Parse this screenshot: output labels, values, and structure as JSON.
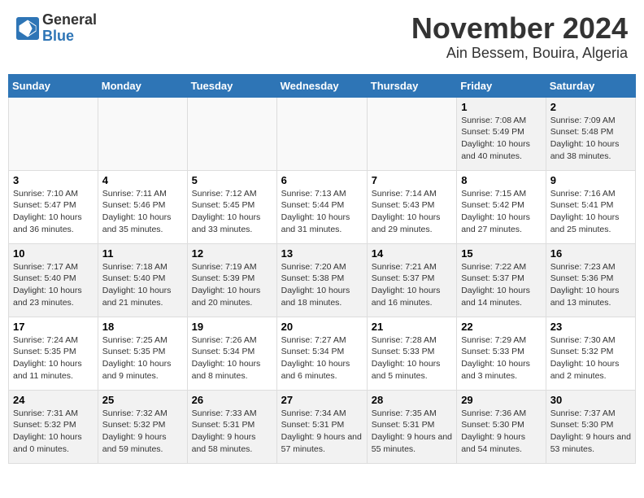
{
  "header": {
    "logo_general": "General",
    "logo_blue": "Blue",
    "month": "November 2024",
    "location": "Ain Bessem, Bouira, Algeria"
  },
  "days_of_week": [
    "Sunday",
    "Monday",
    "Tuesday",
    "Wednesday",
    "Thursday",
    "Friday",
    "Saturday"
  ],
  "weeks": [
    [
      {
        "day": "",
        "info": ""
      },
      {
        "day": "",
        "info": ""
      },
      {
        "day": "",
        "info": ""
      },
      {
        "day": "",
        "info": ""
      },
      {
        "day": "",
        "info": ""
      },
      {
        "day": "1",
        "info": "Sunrise: 7:08 AM\nSunset: 5:49 PM\nDaylight: 10 hours and 40 minutes."
      },
      {
        "day": "2",
        "info": "Sunrise: 7:09 AM\nSunset: 5:48 PM\nDaylight: 10 hours and 38 minutes."
      }
    ],
    [
      {
        "day": "3",
        "info": "Sunrise: 7:10 AM\nSunset: 5:47 PM\nDaylight: 10 hours and 36 minutes."
      },
      {
        "day": "4",
        "info": "Sunrise: 7:11 AM\nSunset: 5:46 PM\nDaylight: 10 hours and 35 minutes."
      },
      {
        "day": "5",
        "info": "Sunrise: 7:12 AM\nSunset: 5:45 PM\nDaylight: 10 hours and 33 minutes."
      },
      {
        "day": "6",
        "info": "Sunrise: 7:13 AM\nSunset: 5:44 PM\nDaylight: 10 hours and 31 minutes."
      },
      {
        "day": "7",
        "info": "Sunrise: 7:14 AM\nSunset: 5:43 PM\nDaylight: 10 hours and 29 minutes."
      },
      {
        "day": "8",
        "info": "Sunrise: 7:15 AM\nSunset: 5:42 PM\nDaylight: 10 hours and 27 minutes."
      },
      {
        "day": "9",
        "info": "Sunrise: 7:16 AM\nSunset: 5:41 PM\nDaylight: 10 hours and 25 minutes."
      }
    ],
    [
      {
        "day": "10",
        "info": "Sunrise: 7:17 AM\nSunset: 5:40 PM\nDaylight: 10 hours and 23 minutes."
      },
      {
        "day": "11",
        "info": "Sunrise: 7:18 AM\nSunset: 5:40 PM\nDaylight: 10 hours and 21 minutes."
      },
      {
        "day": "12",
        "info": "Sunrise: 7:19 AM\nSunset: 5:39 PM\nDaylight: 10 hours and 20 minutes."
      },
      {
        "day": "13",
        "info": "Sunrise: 7:20 AM\nSunset: 5:38 PM\nDaylight: 10 hours and 18 minutes."
      },
      {
        "day": "14",
        "info": "Sunrise: 7:21 AM\nSunset: 5:37 PM\nDaylight: 10 hours and 16 minutes."
      },
      {
        "day": "15",
        "info": "Sunrise: 7:22 AM\nSunset: 5:37 PM\nDaylight: 10 hours and 14 minutes."
      },
      {
        "day": "16",
        "info": "Sunrise: 7:23 AM\nSunset: 5:36 PM\nDaylight: 10 hours and 13 minutes."
      }
    ],
    [
      {
        "day": "17",
        "info": "Sunrise: 7:24 AM\nSunset: 5:35 PM\nDaylight: 10 hours and 11 minutes."
      },
      {
        "day": "18",
        "info": "Sunrise: 7:25 AM\nSunset: 5:35 PM\nDaylight: 10 hours and 9 minutes."
      },
      {
        "day": "19",
        "info": "Sunrise: 7:26 AM\nSunset: 5:34 PM\nDaylight: 10 hours and 8 minutes."
      },
      {
        "day": "20",
        "info": "Sunrise: 7:27 AM\nSunset: 5:34 PM\nDaylight: 10 hours and 6 minutes."
      },
      {
        "day": "21",
        "info": "Sunrise: 7:28 AM\nSunset: 5:33 PM\nDaylight: 10 hours and 5 minutes."
      },
      {
        "day": "22",
        "info": "Sunrise: 7:29 AM\nSunset: 5:33 PM\nDaylight: 10 hours and 3 minutes."
      },
      {
        "day": "23",
        "info": "Sunrise: 7:30 AM\nSunset: 5:32 PM\nDaylight: 10 hours and 2 minutes."
      }
    ],
    [
      {
        "day": "24",
        "info": "Sunrise: 7:31 AM\nSunset: 5:32 PM\nDaylight: 10 hours and 0 minutes."
      },
      {
        "day": "25",
        "info": "Sunrise: 7:32 AM\nSunset: 5:32 PM\nDaylight: 9 hours and 59 minutes."
      },
      {
        "day": "26",
        "info": "Sunrise: 7:33 AM\nSunset: 5:31 PM\nDaylight: 9 hours and 58 minutes."
      },
      {
        "day": "27",
        "info": "Sunrise: 7:34 AM\nSunset: 5:31 PM\nDaylight: 9 hours and 57 minutes."
      },
      {
        "day": "28",
        "info": "Sunrise: 7:35 AM\nSunset: 5:31 PM\nDaylight: 9 hours and 55 minutes."
      },
      {
        "day": "29",
        "info": "Sunrise: 7:36 AM\nSunset: 5:30 PM\nDaylight: 9 hours and 54 minutes."
      },
      {
        "day": "30",
        "info": "Sunrise: 7:37 AM\nSunset: 5:30 PM\nDaylight: 9 hours and 53 minutes."
      }
    ]
  ]
}
